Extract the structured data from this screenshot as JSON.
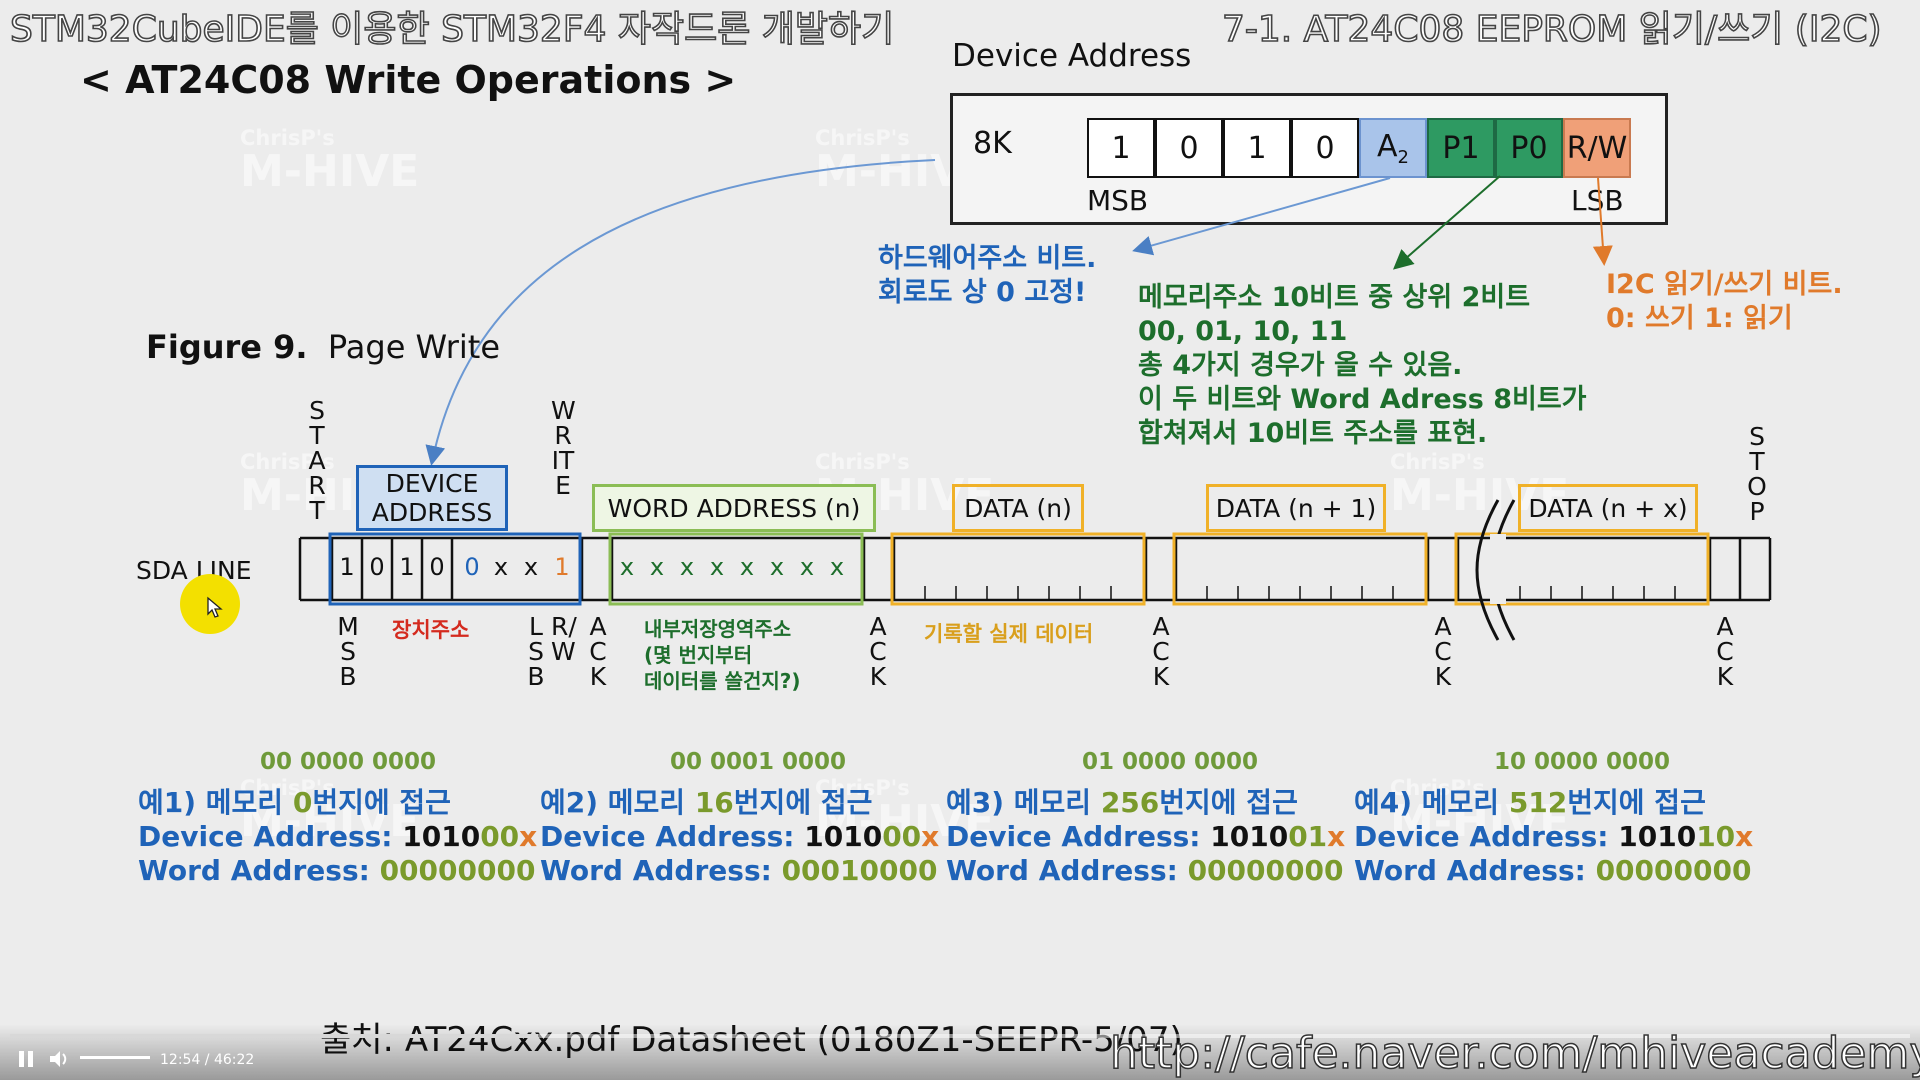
{
  "header": {
    "left": "STM32CubeIDE를 이용한 STM32F4 자작드론 개발하기",
    "right": "7-1. AT24C08 EEPROM 읽기/쓰기 (I2C)"
  },
  "slide_title": "< AT24C08 Write Operations >",
  "device_address": {
    "label": "Device Address",
    "size": "8K",
    "bits": [
      "1",
      "0",
      "1",
      "0",
      "A2",
      "P1",
      "P0",
      "R/W"
    ],
    "msb": "MSB",
    "lsb": "LSB",
    "colors": {
      "a2": "#a9c4ea",
      "p": "#2e9a62",
      "rw": "#f0a078"
    }
  },
  "notes": {
    "hw_line1": "하드웨어주소 비트.",
    "hw_line2": "회로도 상 0 고정!",
    "mem_line1": "메모리주소 10비트 중 상위 2비트",
    "mem_line2": "00, 01, 10, 11",
    "mem_line3": "총 4가지 경우가 올 수 있음.",
    "mem_line4": "이 두 비트와 Word Adress 8비트가",
    "mem_line5": "합쳐져서 10비트 주소를 표현.",
    "rw_line1": "I2C 읽기/쓰기 비트.",
    "rw_line2": "0: 쓰기 1: 읽기"
  },
  "figure": {
    "num": "Figure 9.",
    "title": "Page Write",
    "start": "START",
    "write": "WRITE",
    "stop": "STOP",
    "ack": "ACK",
    "msb": "MSB",
    "lsb": "LSB",
    "rw": "R/W",
    "sda_line": "SDA LINE",
    "device_address_box": "DEVICE ADDRESS",
    "word_address_box": "WORD ADDRESS (n)",
    "data_n": "DATA (n)",
    "data_n1": "DATA (n + 1)",
    "data_nx": "DATA (n + x)",
    "device_bits": [
      "1",
      "0",
      "1",
      "0",
      "0",
      "x",
      "x",
      "1"
    ],
    "word_bits": [
      "x",
      "x",
      "x",
      "x",
      "x",
      "x",
      "x",
      "x"
    ],
    "device_caption": "장치주소",
    "word_caption_1": "내부저장영역주소",
    "word_caption_2": "(몇 번지부터",
    "word_caption_3": "데이터를 쓸건지?)",
    "data_caption": "기록할 실제 데이터"
  },
  "examples": [
    {
      "bin": "00 0000 0000",
      "t_pre": "예1) 메모리 ",
      "t_num": "0",
      "t_post": "번지에 접근",
      "dev_label": "Device Address: ",
      "dev_fixed": "1010",
      "dev_bits": "00",
      "dev_x": "x",
      "word_label": "Word Address: ",
      "word_val": "00000000"
    },
    {
      "bin": "00 0001 0000",
      "t_pre": "예2) 메모리 ",
      "t_num": "16",
      "t_post": "번지에 접근",
      "dev_label": "Device Address: ",
      "dev_fixed": "1010",
      "dev_bits": "00",
      "dev_x": "x",
      "word_label": "Word Address: ",
      "word_val": "00010000"
    },
    {
      "bin": "01 0000 0000",
      "t_pre": "예3) 메모리 ",
      "t_num": "256",
      "t_post": "번지에 접근",
      "dev_label": "Device Address: ",
      "dev_fixed": "1010",
      "dev_bits": "01",
      "dev_x": "x",
      "word_label": "Word Address: ",
      "word_val": "00000000"
    },
    {
      "bin": "10 0000 0000",
      "t_pre": "예4) 메모리 ",
      "t_num": "512",
      "t_post": "번지에 접근",
      "dev_label": "Device Address: ",
      "dev_fixed": "1010",
      "dev_bits": "10",
      "dev_x": "x",
      "word_label": "Word Address: ",
      "word_val": "00000000"
    }
  ],
  "watermark": {
    "small": "ChrisP's",
    "big": "M-HIVE"
  },
  "source": "출처: AT24Cxx.pdf Datasheet (0180Z1-SEEPR-5/07)",
  "url": "http://cafe.naver.com/mhiveacademy",
  "player": {
    "time": "12:54 / 46:22",
    "progress": 0.278,
    "volume": 1.0,
    "pause_icon": "pause-icon",
    "volume_icon": "volume-icon"
  }
}
